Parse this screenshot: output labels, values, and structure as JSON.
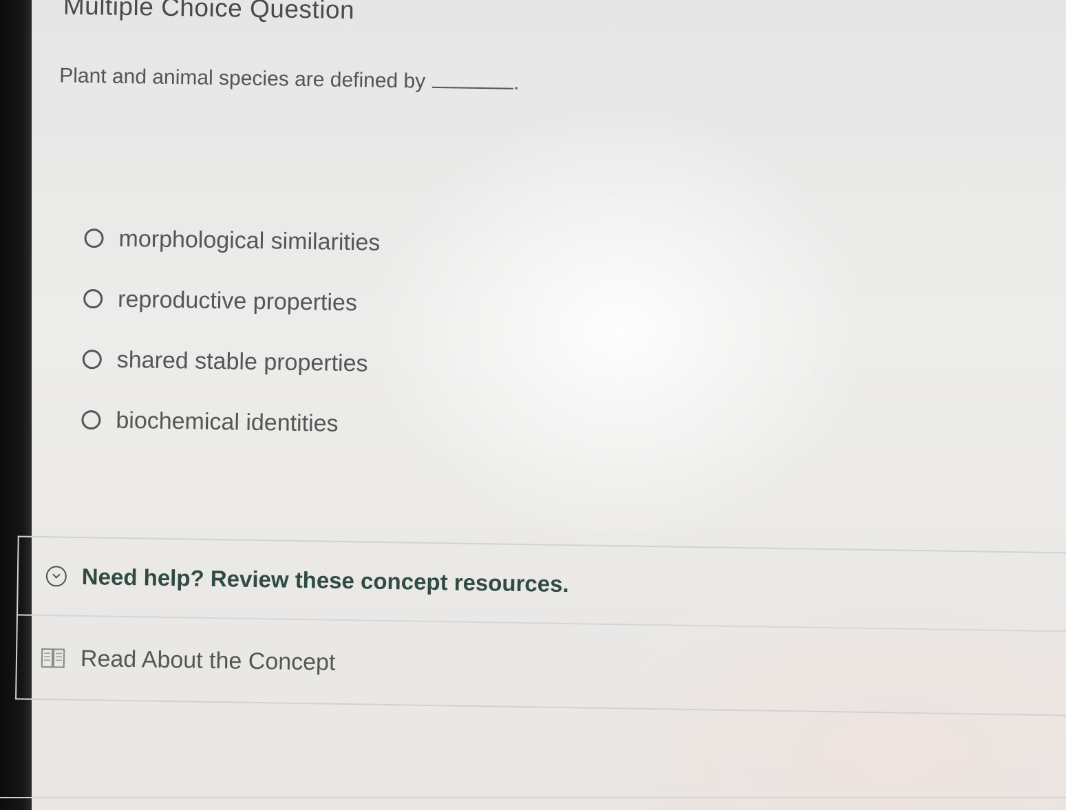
{
  "question": {
    "heading": "Multiple Choice Question",
    "prompt": "Plant and animal species are defined by",
    "prompt_end": "."
  },
  "options": [
    {
      "label": "morphological similarities",
      "selected": false
    },
    {
      "label": "reproductive properties",
      "selected": false
    },
    {
      "label": "shared stable properties",
      "selected": false
    },
    {
      "label": "biochemical identities",
      "selected": false
    }
  ],
  "help": {
    "title": "Need help? Review these concept resources.",
    "icon": "chevron-down-circle-icon",
    "resources": [
      {
        "label": "Read About the Concept",
        "icon": "book-icon"
      }
    ]
  },
  "colors": {
    "help_title": "#2f4b44",
    "text": "#555555"
  }
}
